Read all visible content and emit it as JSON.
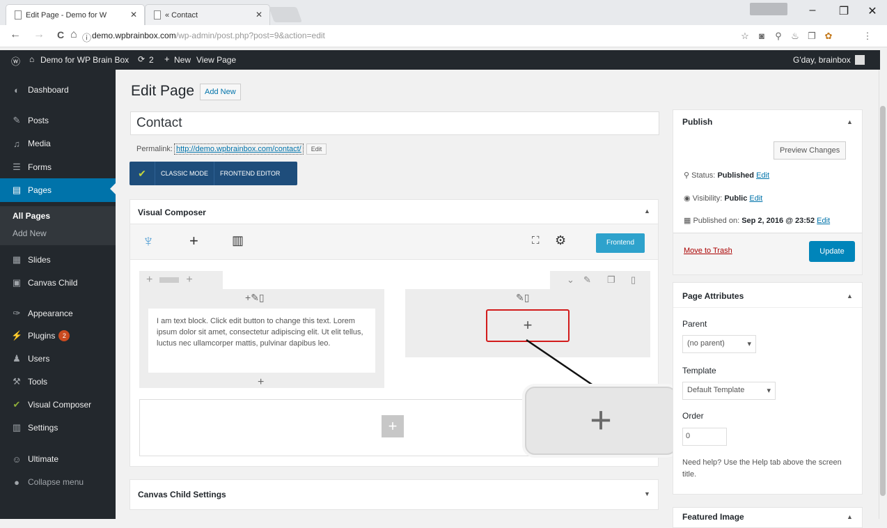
{
  "browser": {
    "tabs": [
      {
        "label": "Edit Page - Demo for W",
        "close": "✕"
      },
      {
        "label": "« Contact",
        "close": "✕"
      }
    ],
    "window": {
      "minimize": "–",
      "maximize": "❐",
      "close": "✕"
    },
    "nav": {
      "back": "←",
      "forward": "→",
      "reload": "C",
      "home": "⌂",
      "info": "ⓘ"
    },
    "url": {
      "host": "demo.wpbrainbox.com",
      "path": "/wp-admin/post.php?post=9&action=edit"
    },
    "icons": [
      "star-icon",
      "camera-icon",
      "search-icon",
      "extension-icon",
      "copy-icon",
      "extension-icon",
      "menu-icon"
    ]
  },
  "adminbar": {
    "site": "Demo for WP Brain Box",
    "updates": "2",
    "new": "New",
    "view": "View Page",
    "greeting": "G'day, brainbox"
  },
  "sidebar": {
    "items": [
      {
        "label": "Dashboard",
        "icon": "◐"
      },
      {
        "label": "Posts",
        "icon": "✎"
      },
      {
        "label": "Media",
        "icon": "♫"
      },
      {
        "label": "Forms",
        "icon": "☰"
      },
      {
        "label": "Pages",
        "icon": "▤"
      },
      {
        "label": "Slides",
        "icon": "▦"
      },
      {
        "label": "Canvas Child",
        "icon": "▣"
      },
      {
        "label": "Appearance",
        "icon": "✑"
      },
      {
        "label": "Plugins",
        "icon": "⚡"
      },
      {
        "label": "Users",
        "icon": "♟"
      },
      {
        "label": "Tools",
        "icon": "⚒"
      },
      {
        "label": "Visual Composer",
        "icon": "✔"
      },
      {
        "label": "Settings",
        "icon": "▥"
      },
      {
        "label": "Ultimate",
        "icon": "☺"
      },
      {
        "label": "Collapse menu",
        "icon": "●"
      }
    ],
    "sub": {
      "all_pages": "All Pages",
      "add_new": "Add New"
    },
    "plugins_badge": "2"
  },
  "editor": {
    "page_title": "Edit Page",
    "add_new": "Add New",
    "title_value": "Contact",
    "permalink_label": "Permalink:",
    "permalink_url": "http://demo.wpbrainbox.com/contact/",
    "permalink_edit": "Edit",
    "vc_classic": "CLASSIC MODE",
    "vc_frontend_editor": "FRONTEND EDITOR"
  },
  "vc": {
    "title": "Visual Composer",
    "toggle": "▲",
    "frontend": "Frontend",
    "text_block": "I am text block. Click edit button to change this text. Lorem ipsum dolor sit amet, consectetur adipiscing elit. Ut elit tellus, luctus nec ullamcorper mattis, pulvinar dapibus leo."
  },
  "canvas_settings": {
    "title": "Canvas Child Settings",
    "toggle": "▼"
  },
  "publish": {
    "title": "Publish",
    "toggle": "▲",
    "preview": "Preview Changes",
    "status_label": "Status:",
    "status_value": "Published",
    "visibility_label": "Visibility:",
    "visibility_value": "Public",
    "published_label": "Published on:",
    "published_value": "Sep 2, 2016 @ 23:52",
    "edit": "Edit",
    "trash": "Move to Trash",
    "update": "Update"
  },
  "attributes": {
    "title": "Page Attributes",
    "toggle": "▲",
    "parent_label": "Parent",
    "parent_value": "(no parent)",
    "template_label": "Template",
    "template_value": "Default Template",
    "order_label": "Order",
    "order_value": "0",
    "help": "Need help? Use the Help tab above the screen title."
  },
  "featured": {
    "title": "Featured Image",
    "toggle": "▲"
  },
  "colors": {
    "admin_dark": "#23282d",
    "wp_blue": "#0073aa",
    "highlight_red": "#d21b1b",
    "vc_blue": "#1e4d7b"
  }
}
